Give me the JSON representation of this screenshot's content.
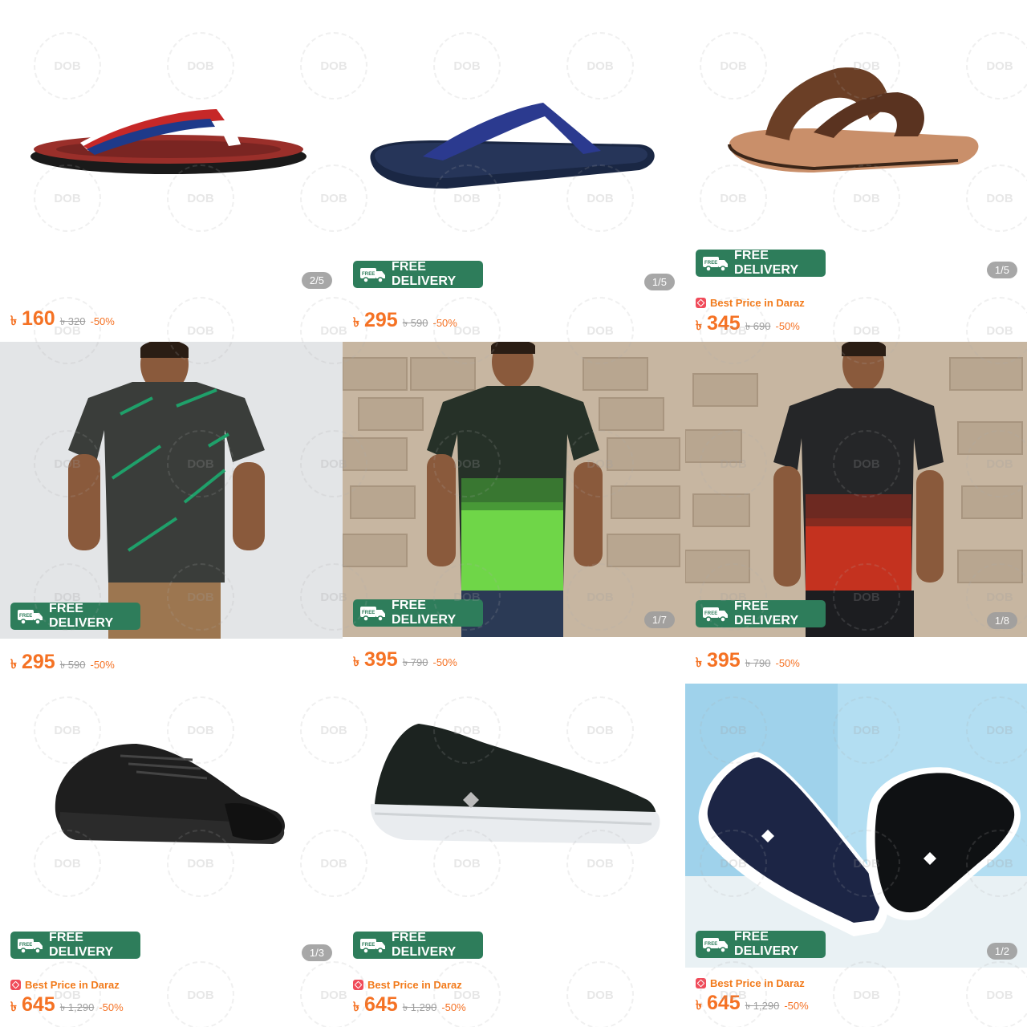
{
  "currency": "৳",
  "free_delivery_label": "FREE DELIVERY",
  "free_tag": "FREE",
  "best_price_label": "Best Price in Daraz",
  "watermark": "DOB",
  "products": [
    {
      "name": "Flip flop sandal red",
      "counter": "2/5",
      "price": "160",
      "original": "৳ 320",
      "discount": "-50%",
      "free_delivery": false,
      "best_price": false
    },
    {
      "name": "Navy thong sandal",
      "counter": "1/5",
      "price": "295",
      "original": "৳ 590",
      "discount": "-50%",
      "free_delivery": true,
      "best_price": false
    },
    {
      "name": "Brown leather sandal",
      "counter": "1/5",
      "price": "345",
      "original": "৳ 690",
      "discount": "-50%",
      "free_delivery": true,
      "best_price": true
    },
    {
      "name": "Grey green t-shirt",
      "counter": "",
      "price": "295",
      "original": "৳ 590",
      "discount": "-50%",
      "free_delivery": true,
      "best_price": false
    },
    {
      "name": "Green gradient t-shirt",
      "counter": "1/7",
      "price": "395",
      "original": "৳ 790",
      "discount": "-50%",
      "free_delivery": true,
      "best_price": false
    },
    {
      "name": "Red gradient t-shirt",
      "counter": "1/8",
      "price": "395",
      "original": "৳ 790",
      "discount": "-50%",
      "free_delivery": true,
      "best_price": false
    },
    {
      "name": "Black canvas sneaker",
      "counter": "1/3",
      "price": "645",
      "original": "৳ 1,290",
      "discount": "-50%",
      "free_delivery": true,
      "best_price": true
    },
    {
      "name": "Black slip-on shoe",
      "counter": "",
      "price": "645",
      "original": "৳ 1,290",
      "discount": "-50%",
      "free_delivery": true,
      "best_price": true
    },
    {
      "name": "Navy slip-on shoes",
      "counter": "1/2",
      "price": "645",
      "original": "৳ 1,290",
      "discount": "-50%",
      "free_delivery": true,
      "best_price": true
    }
  ],
  "colors": {
    "accent": "#f57224",
    "delivery_badge": "#2e7d5b",
    "counter_bg": "#9e9e9e",
    "best_price": "#f27a1a"
  }
}
